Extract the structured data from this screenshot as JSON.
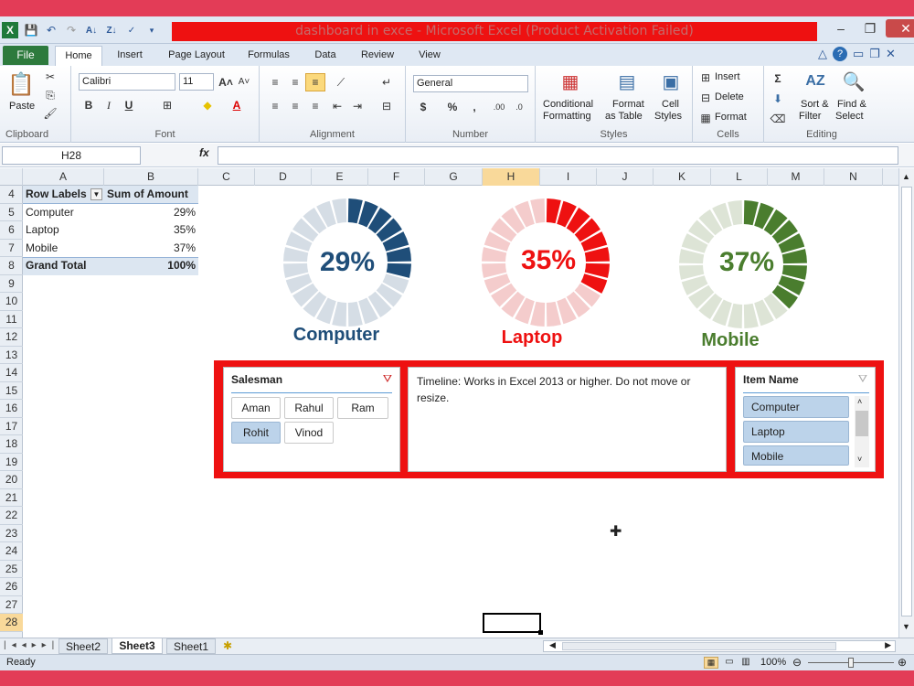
{
  "window": {
    "title": "dashboard in exce  -  Microsoft Excel (Product Activation Failed)"
  },
  "tabs": {
    "file": "File",
    "home": "Home",
    "insert": "Insert",
    "page_layout": "Page Layout",
    "formulas": "Formulas",
    "data": "Data",
    "review": "Review",
    "view": "View"
  },
  "ribbon": {
    "clipboard": {
      "label": "Clipboard",
      "paste": "Paste"
    },
    "font": {
      "label": "Font",
      "name": "Calibri",
      "size": "11"
    },
    "alignment": {
      "label": "Alignment"
    },
    "number": {
      "label": "Number",
      "format": "General"
    },
    "styles": {
      "label": "Styles",
      "conditional": "Conditional",
      "formatting": "Formatting",
      "format_as": "Format",
      "as_table": "as Table",
      "cell": "Cell",
      "cell_styles": "Styles"
    },
    "cells": {
      "label": "Cells",
      "insert": "Insert",
      "delete": "Delete",
      "format": "Format"
    },
    "editing": {
      "label": "Editing",
      "sort": "Sort &",
      "filter": "Filter",
      "find": "Find &",
      "select": "Select"
    }
  },
  "formula_bar": {
    "name_box": "H28",
    "fx": "fx",
    "value": ""
  },
  "columns": [
    "A",
    "B",
    "C",
    "D",
    "E",
    "F",
    "G",
    "H",
    "I",
    "J",
    "K",
    "L",
    "M",
    "N"
  ],
  "rows": [
    "4",
    "5",
    "6",
    "7",
    "8",
    "9",
    "10",
    "11",
    "12",
    "13",
    "14",
    "15",
    "16",
    "17",
    "18",
    "19",
    "20",
    "21",
    "22",
    "23",
    "24",
    "25",
    "26",
    "27",
    "28"
  ],
  "pivot": {
    "header_labels": "Row Labels",
    "header_sum": "Sum of Amount",
    "rows": [
      {
        "label": "Computer",
        "value": "29%"
      },
      {
        "label": "Laptop",
        "value": "35%"
      },
      {
        "label": "Mobile",
        "value": "37%"
      }
    ],
    "total_label": "Grand Total",
    "total_value": "100%"
  },
  "donuts": [
    {
      "percent": 0.29,
      "label": "29%",
      "name": "Computer",
      "color": "#1f4e79",
      "light": "#d5dde5"
    },
    {
      "percent": 0.35,
      "label": "35%",
      "name": "Laptop",
      "color": "#ee1111",
      "light": "#f4cccc"
    },
    {
      "percent": 0.37,
      "label": "37%",
      "name": "Mobile",
      "color": "#4a7d2e",
      "light": "#dde4d6"
    }
  ],
  "slicers": {
    "salesman": {
      "title": "Salesman",
      "items": [
        "Aman",
        "Rahul",
        "Ram",
        "Rohit",
        "Vinod"
      ],
      "selected": "Rohit"
    },
    "timeline": {
      "text": "Timeline: Works in Excel 2013 or higher. Do not move or resize."
    },
    "item_name": {
      "title": "Item Name",
      "items": [
        "Computer",
        "Laptop",
        "Mobile"
      ]
    }
  },
  "sheets": {
    "tabs": [
      "Sheet2",
      "Sheet3",
      "Sheet1"
    ],
    "active": "Sheet3"
  },
  "status": {
    "ready": "Ready",
    "zoom": "100%"
  }
}
